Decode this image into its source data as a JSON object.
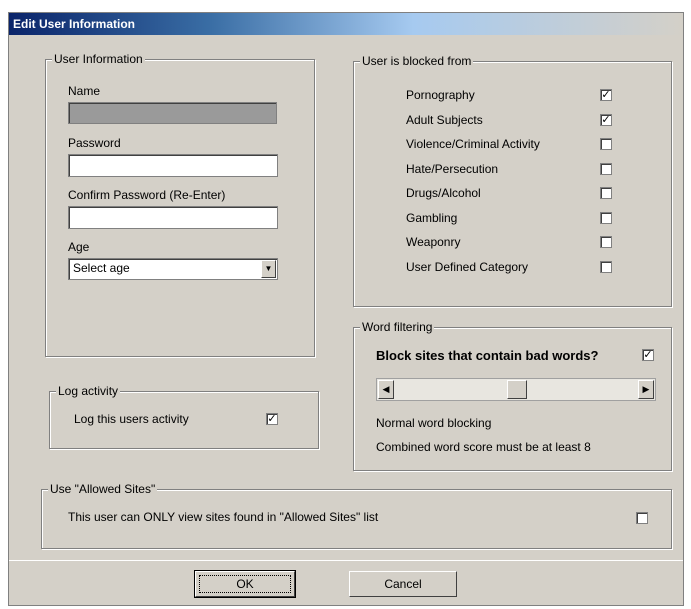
{
  "window": {
    "title": "Edit User Information"
  },
  "user_info": {
    "legend": "User Information",
    "name_label": "Name",
    "name_value": "",
    "password_label": "Password",
    "confirm_label": "Confirm Password (Re-Enter)",
    "age_label": "Age",
    "age_selected": "Select age"
  },
  "blocked": {
    "legend": "User is blocked from",
    "items": [
      {
        "label": "Pornography",
        "checked": true
      },
      {
        "label": "Adult Subjects",
        "checked": true
      },
      {
        "label": "Violence/Criminal Activity",
        "checked": false
      },
      {
        "label": "Hate/Persecution",
        "checked": false
      },
      {
        "label": "Drugs/Alcohol",
        "checked": false
      },
      {
        "label": "Gambling",
        "checked": false
      },
      {
        "label": "Weaponry",
        "checked": false
      },
      {
        "label": "User Defined Category",
        "checked": false
      }
    ]
  },
  "word_filter": {
    "legend": "Word filtering",
    "question": "Block sites that contain bad words?",
    "checked": true,
    "level_text": "Normal word blocking",
    "score_text": "Combined word score must be at least 8",
    "slider_fraction": 0.5
  },
  "log": {
    "legend": "Log activity",
    "label": "Log this users activity",
    "checked": true
  },
  "allowed": {
    "legend": "Use \"Allowed Sites\"",
    "label": "This user can ONLY view sites found in \"Allowed Sites\"  list",
    "checked": false
  },
  "buttons": {
    "ok": "OK",
    "cancel": "Cancel"
  }
}
